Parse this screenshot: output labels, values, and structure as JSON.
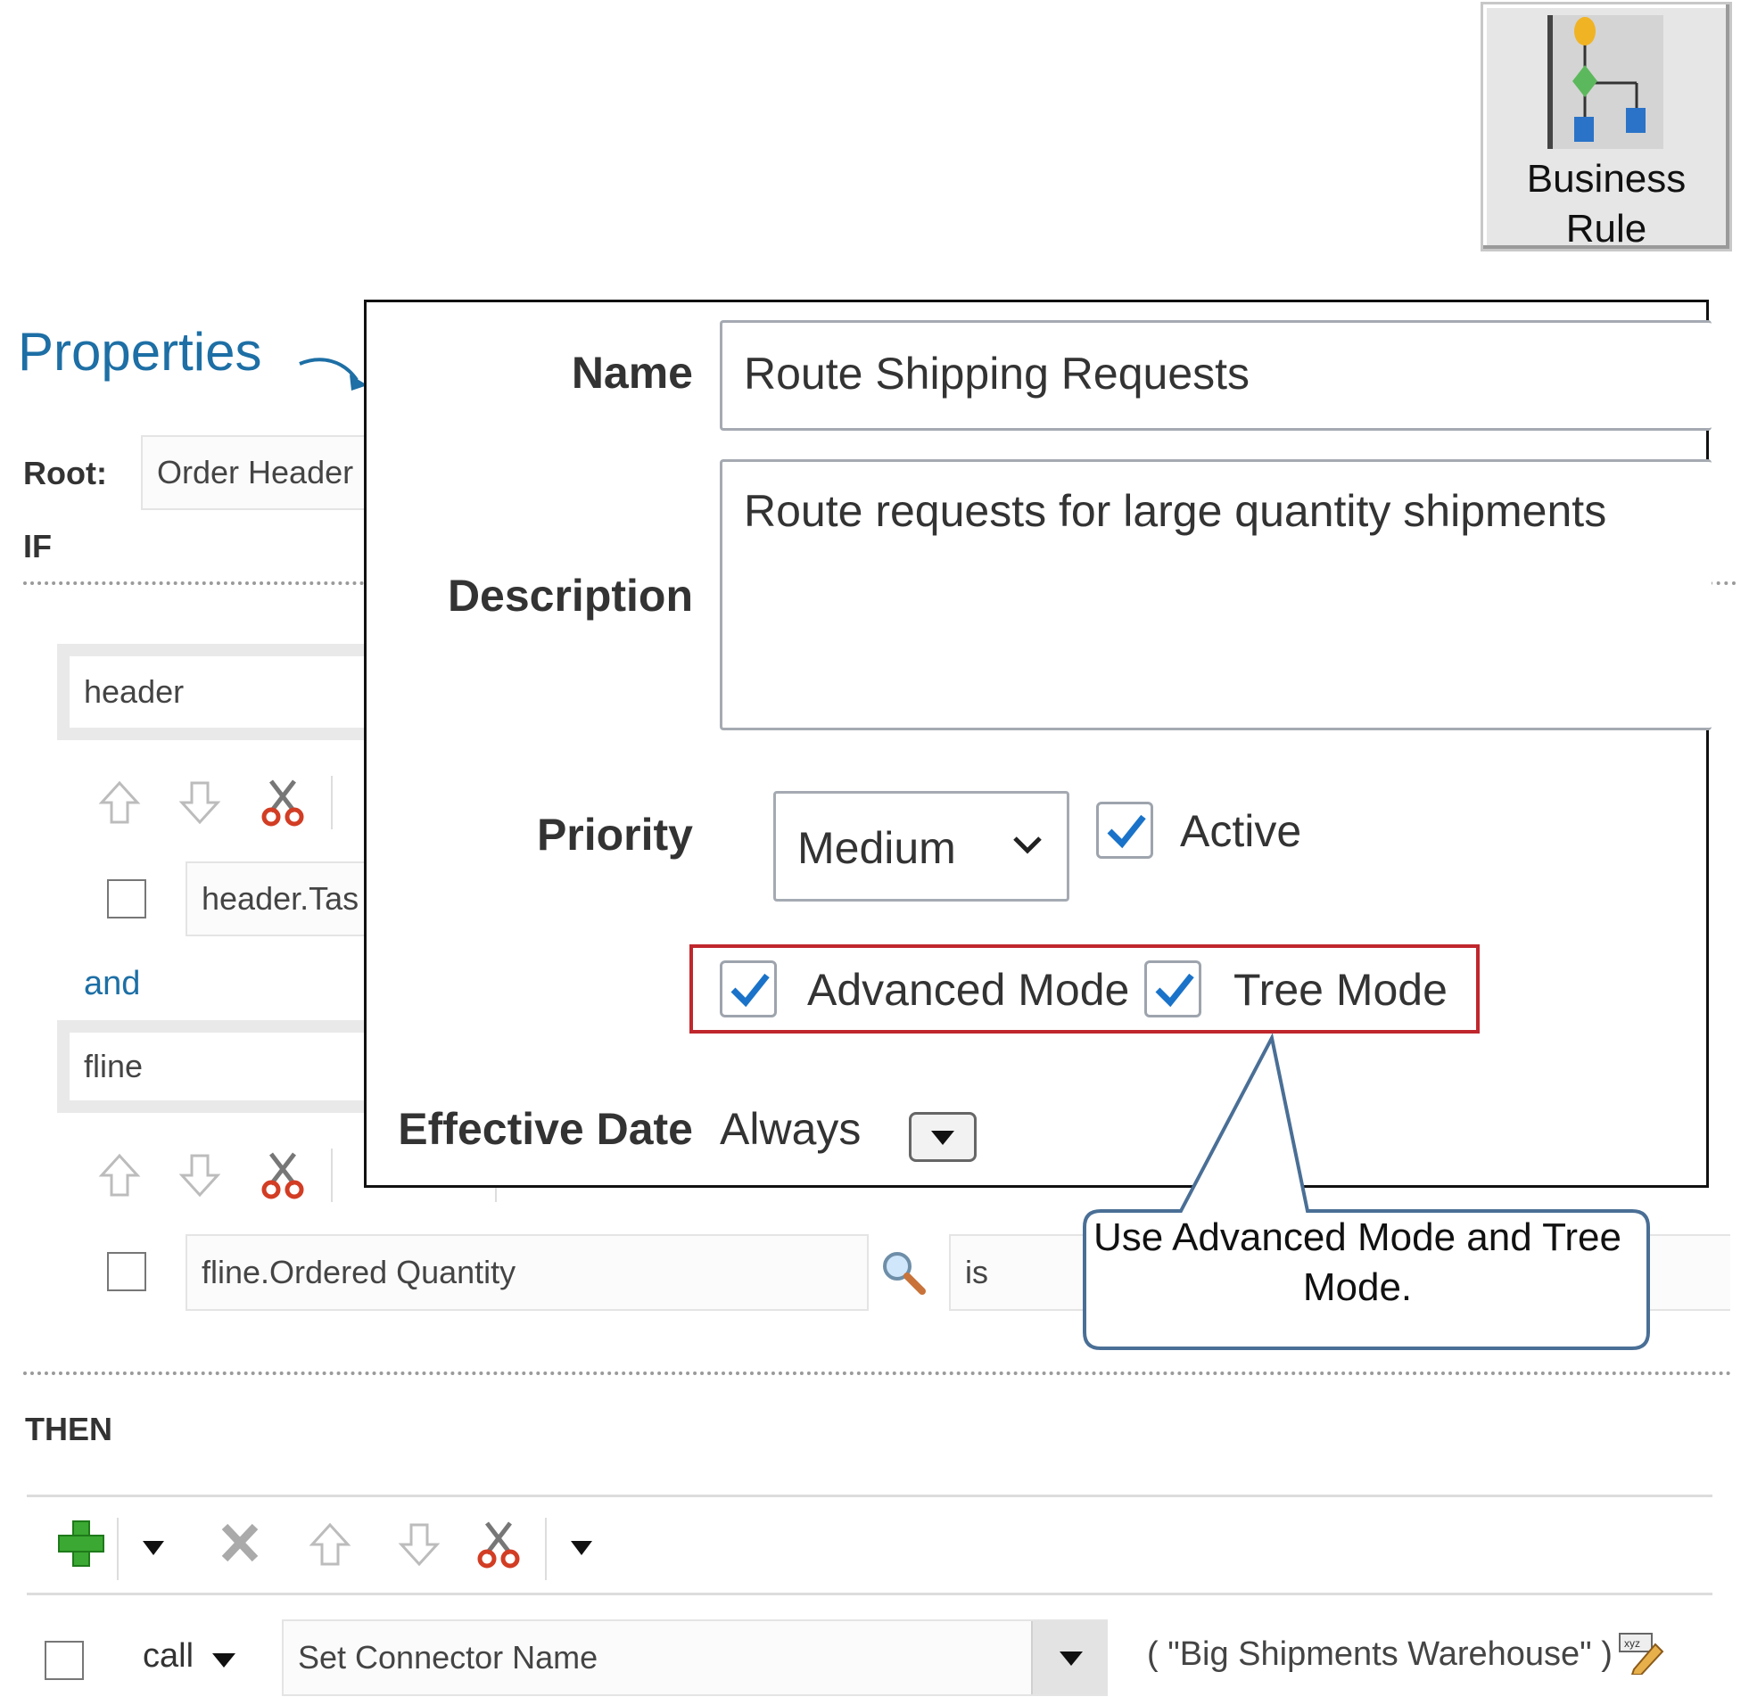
{
  "tile": {
    "label": "Business\nRule",
    "icon": "business-rule-flowchart-icon"
  },
  "editor": {
    "properties_heading": "Properties",
    "root_label": "Root:",
    "root_value": "Order Header",
    "if_label": "IF",
    "then_label": "THEN",
    "and_label": "and",
    "conditions": [
      {
        "variable": "header",
        "expression": "header.Tas"
      },
      {
        "variable": "fline",
        "expression": "fline.Ordered Quantity",
        "operator": "is"
      }
    ],
    "action": {
      "verb": "call",
      "function": "Set Connector Name",
      "arguments": "( \"Big Shipments Warehouse\" )"
    }
  },
  "properties_dialog": {
    "name_label": "Name",
    "name_value": "Route Shipping Requests",
    "description_label": "Description",
    "description_value": "Route requests for large quantity shipments",
    "priority_label": "Priority",
    "priority_value": "Medium",
    "active_label": "Active",
    "active_checked": true,
    "advanced_mode_label": "Advanced Mode",
    "advanced_mode_checked": true,
    "tree_mode_label": "Tree Mode",
    "tree_mode_checked": true,
    "effective_date_label": "Effective Date",
    "effective_date_value": "Always"
  },
  "callout": {
    "text": "Use Advanced Mode and Tree Mode."
  },
  "colors": {
    "accent": "#1d6fa5",
    "check": "#1a73c9",
    "highlight_border": "#c0272d",
    "callout_border": "#4a6f96"
  }
}
